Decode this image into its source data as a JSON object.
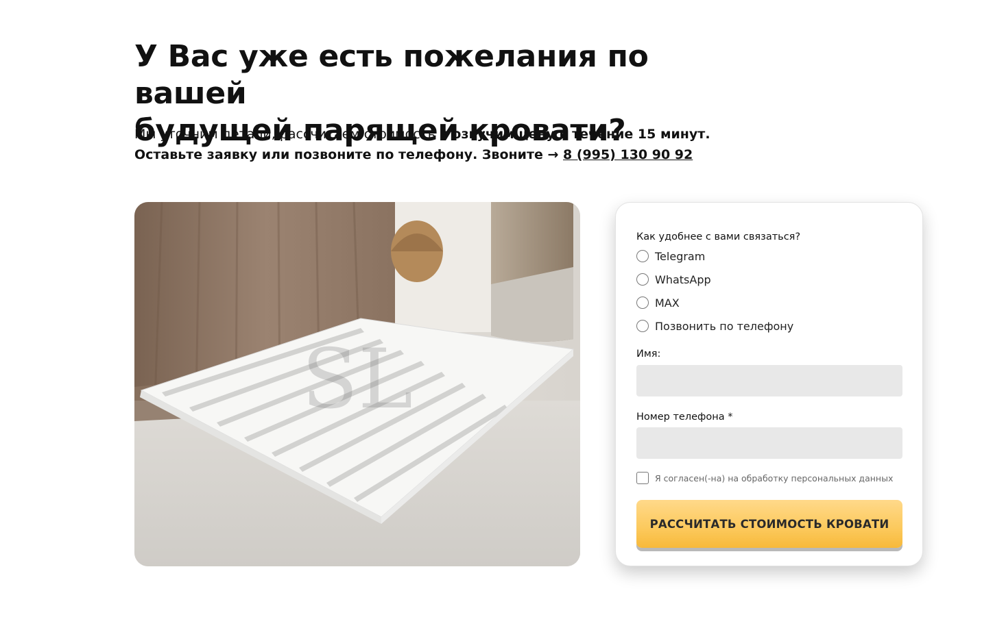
{
  "heading": {
    "line1": "У Вас уже есть пожелания по вашей",
    "line2": "будущей парящей кровати?"
  },
  "subtitle": {
    "part1": "Мы уточним детали, рассчитаем стоимость и ",
    "part1_bold": "озвучим цену в течение 15 минут.",
    "part2_bold": "Оставьте заявку или позвоните по телефону. Звоните → ",
    "phone": "8 (995) 130 90 92"
  },
  "photo": {
    "watermark": "SL"
  },
  "form": {
    "contact_question": "Как удобнее с вами связаться?",
    "contact_options": [
      "Telegram",
      "WhatsApp",
      "MAX",
      "Позвонить по телефону"
    ],
    "name_label": "Имя:",
    "name_value": "",
    "phone_label": "Номер телефона *",
    "phone_value": "",
    "consent_label": "Я согласен(-на) на обработку персональных данных",
    "submit_label": "РАССЧИТАТЬ СТОИМОСТЬ КРОВАТИ"
  },
  "colors": {
    "button_gradient_top": "#ffd98a",
    "button_gradient_bottom": "#f7b93a",
    "input_bg": "#e8e8e8",
    "text": "#111111"
  }
}
